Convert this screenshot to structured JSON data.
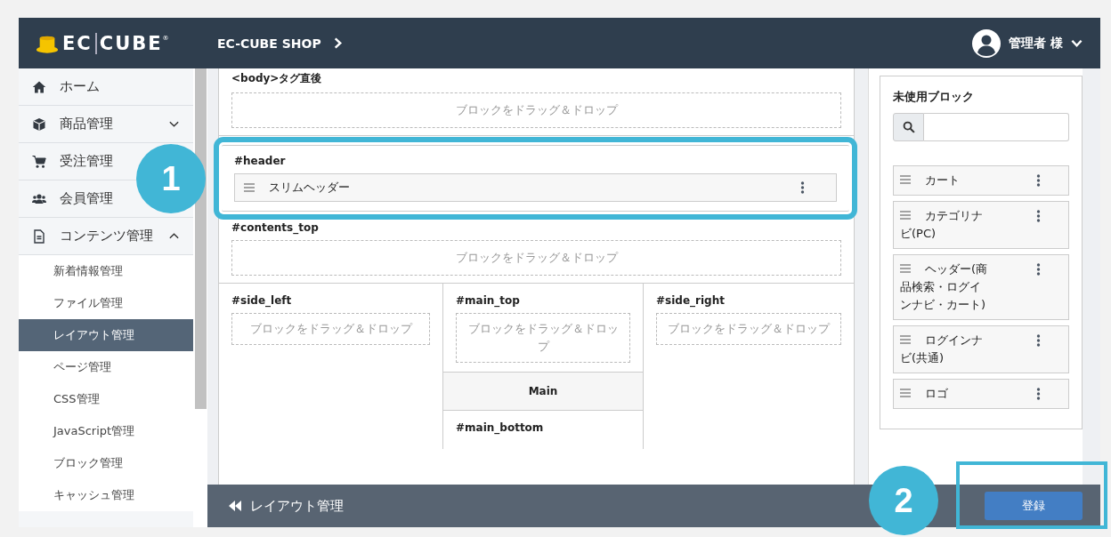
{
  "header": {
    "logo": {
      "left": "EC",
      "right": "CUBE",
      "mark": "®"
    },
    "shop": "EC-CUBE SHOP",
    "user": "管理者 様"
  },
  "sidebar": {
    "items": [
      {
        "label": "ホーム",
        "kind": "home"
      },
      {
        "label": "商品管理",
        "kind": "box",
        "expanded": false
      },
      {
        "label": "受注管理",
        "kind": "cart"
      },
      {
        "label": "会員管理",
        "kind": "users"
      },
      {
        "label": "コンテンツ管理",
        "kind": "file",
        "expanded": true,
        "children": [
          {
            "label": "新着情報管理",
            "selected": false
          },
          {
            "label": "ファイル管理",
            "selected": false
          },
          {
            "label": "レイアウト管理",
            "selected": true
          },
          {
            "label": "ページ管理",
            "selected": false
          },
          {
            "label": "CSS管理",
            "selected": false
          },
          {
            "label": "JavaScript管理",
            "selected": false
          },
          {
            "label": "ブロック管理",
            "selected": false
          },
          {
            "label": "キャッシュ管理",
            "selected": false
          }
        ]
      }
    ]
  },
  "canvas": {
    "sections": [
      {
        "label": "<body>タグ直後",
        "drop": "ブロックをドラッグ＆ドロップ",
        "highlighted": false
      },
      {
        "label": "#header",
        "blocks": [
          "スリムヘッダー"
        ],
        "highlighted": true
      },
      {
        "label": "#contents_top",
        "drop": "ブロックをドラッグ＆ドロップ",
        "highlighted": false
      }
    ],
    "columns": [
      {
        "areas": [
          {
            "kind": "zone",
            "label": "#side_left",
            "drop": "ブロックをドラッグ＆ドロップ"
          }
        ]
      },
      {
        "areas": [
          {
            "kind": "zone",
            "label": "#main_top",
            "drop": "ブロックをドラッグ＆ドロップ"
          },
          {
            "kind": "main",
            "label": "Main"
          },
          {
            "kind": "zone",
            "label": "#main_bottom"
          }
        ]
      },
      {
        "areas": [
          {
            "kind": "zone",
            "label": "#side_right",
            "drop": "ブロックをドラッグ＆ドロップ"
          }
        ]
      }
    ]
  },
  "unused": {
    "title": "未使用ブロック",
    "blocks": [
      "カート",
      "カテゴリナビ(PC)",
      "ヘッダー(商品検索・ログインナビ・カート)",
      "ログインナビ(共通)",
      "ロゴ"
    ]
  },
  "footer": {
    "back": "レイアウト管理",
    "button": "登録",
    "button_highlighted": true
  },
  "callouts": [
    {
      "number": "1"
    },
    {
      "number": "2"
    }
  ]
}
